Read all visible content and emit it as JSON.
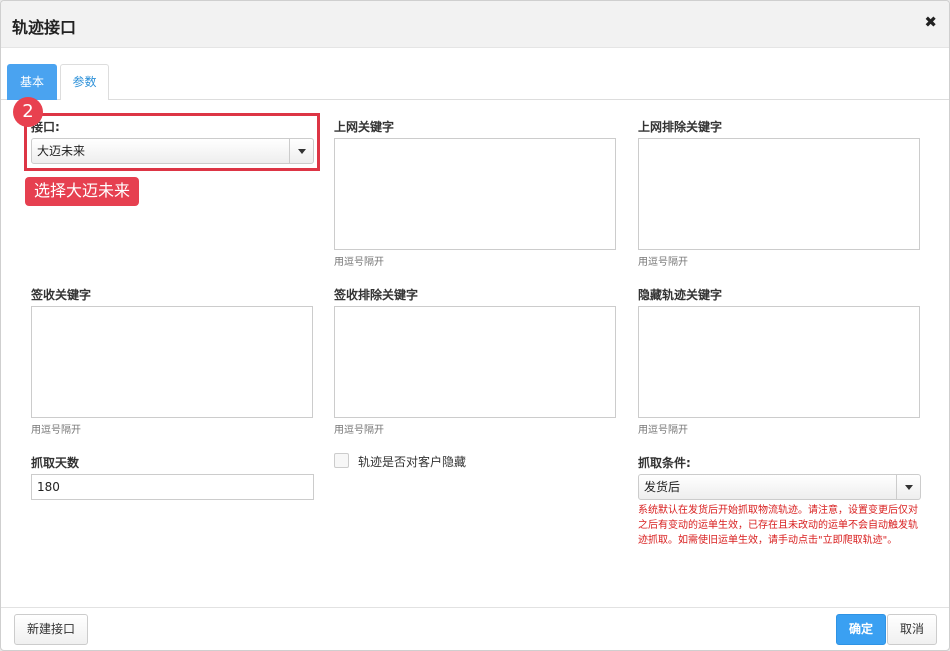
{
  "dialog": {
    "title": "轨迹接口",
    "close_glyph": "✖"
  },
  "tabs": [
    {
      "label": "基本",
      "active": true
    },
    {
      "label": "参数",
      "active": false
    }
  ],
  "fields": {
    "interface": {
      "label": "接口:",
      "value": "大迈未来"
    },
    "online_keywords": {
      "label": "上网关键字",
      "hint": "用逗号隔开",
      "value": ""
    },
    "online_exclude_keywords": {
      "label": "上网排除关键字",
      "hint": "用逗号隔开",
      "value": ""
    },
    "sign_keywords": {
      "label": "签收关键字",
      "hint": "用逗号隔开",
      "value": ""
    },
    "sign_exclude_keywords": {
      "label": "签收排除关键字",
      "hint": "用逗号隔开",
      "value": ""
    },
    "hide_track_keywords": {
      "label": "隐藏轨迹关键字",
      "hint": "用逗号隔开",
      "value": ""
    },
    "fetch_days": {
      "label": "抓取天数",
      "value": "180"
    },
    "hide_from_customer": {
      "label": "轨迹是否对客户隐藏",
      "checked": false
    },
    "fetch_condition": {
      "label": "抓取条件:",
      "value": "发货后",
      "note": "系统默认在发货后开始抓取物流轨迹。请注意，设置变更后仅对之后有变动的运单生效，已存在且未改动的运单不会自动触发轨迹抓取。如需使旧运单生效，请手动点击\"立即爬取轨迹\"。"
    }
  },
  "annotation": {
    "step_number": "2",
    "callout": "选择大迈未来",
    "color": "#e64050"
  },
  "footer": {
    "new_label": "新建接口",
    "ok_label": "确定",
    "cancel_label": "取消"
  },
  "colors": {
    "primary": "#3aa0f2",
    "note_red": "#d81e1e"
  }
}
